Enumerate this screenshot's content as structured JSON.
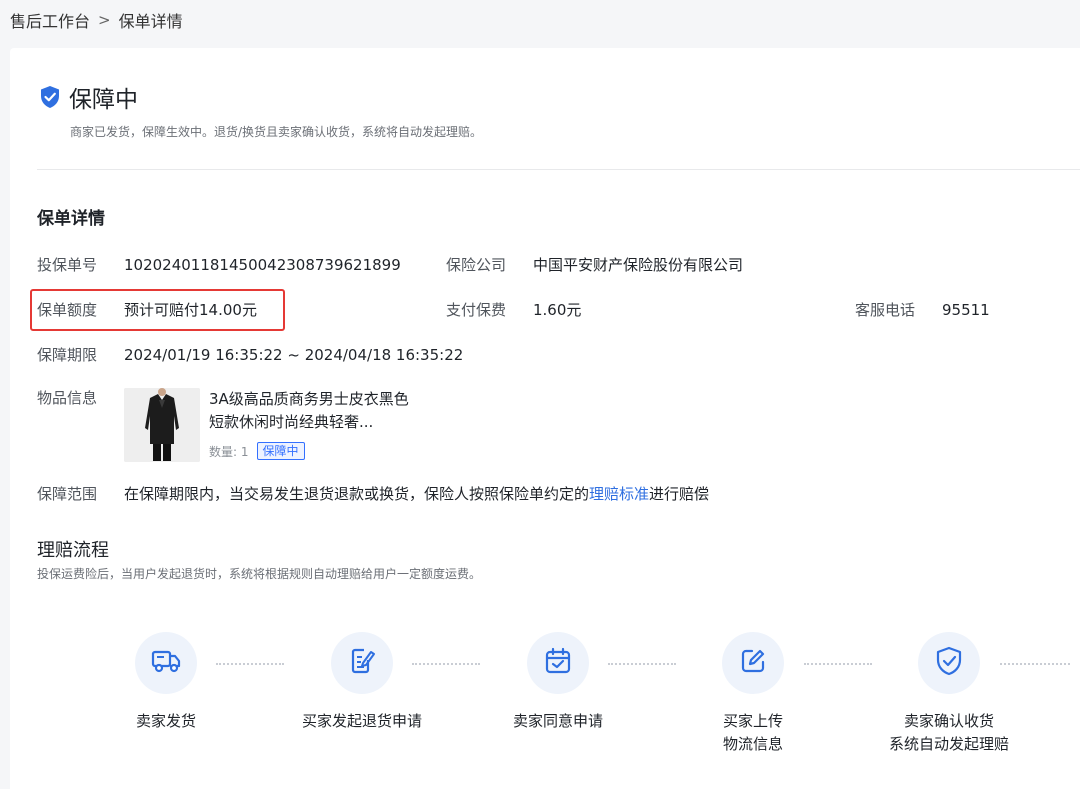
{
  "breadcrumb": {
    "parent": "售后工作台",
    "separator": ">",
    "current": "保单详情"
  },
  "status": {
    "icon": "shield-check-icon",
    "title": "保障中",
    "description": "商家已发货，保障生效中。退货/换货且卖家确认收货，系统将自动发起理赔。"
  },
  "details": {
    "title": "保单详情",
    "policy_no_label": "投保单号",
    "policy_no": "102024011814500423087396218​99",
    "insurer_label": "保险公司",
    "insurer": "中国平安财产保险股份有限公司",
    "coverage_label": "保单额度",
    "coverage": "预计可赔付14.00元",
    "premium_label": "支付保费",
    "premium": "1.60元",
    "phone_label": "客服电话",
    "phone": "95511",
    "period_label": "保障期限",
    "period": "2024/01/19 16:35:22 ~ 2024/04/18 16:35:22",
    "item_label": "物品信息",
    "item_name": "3A级高品质商务男士皮衣黑色短款休闲时尚经典轻奢...",
    "item_qty": "数量: 1",
    "item_tag": "保障中",
    "scope_label": "保障范围",
    "scope_prefix": "在保障期限内，当交易发生退货退款或换货，保险人按照保险单约定的",
    "scope_link": "理赔标准",
    "scope_suffix": "进行赔偿"
  },
  "flow": {
    "title": "理赔流程",
    "description": "投保运费险后，当用户发起退货时，系统将根据规则自动理赔给用户一定额度运费。",
    "steps": [
      {
        "icon": "delivery-truck-icon",
        "label": "卖家发货"
      },
      {
        "icon": "edit-document-icon",
        "label": "买家发起退货申请"
      },
      {
        "icon": "calendar-check-icon",
        "label": "卖家同意申请"
      },
      {
        "icon": "pencil-square-icon",
        "label": "买家上传\n物流信息"
      },
      {
        "icon": "shield-check-icon",
        "label": "卖家确认收货\n系统自动发起理赔"
      }
    ]
  },
  "colors": {
    "accent": "#3370ff",
    "highlight": "#e53935",
    "icon_bg": "#eef3fb"
  }
}
